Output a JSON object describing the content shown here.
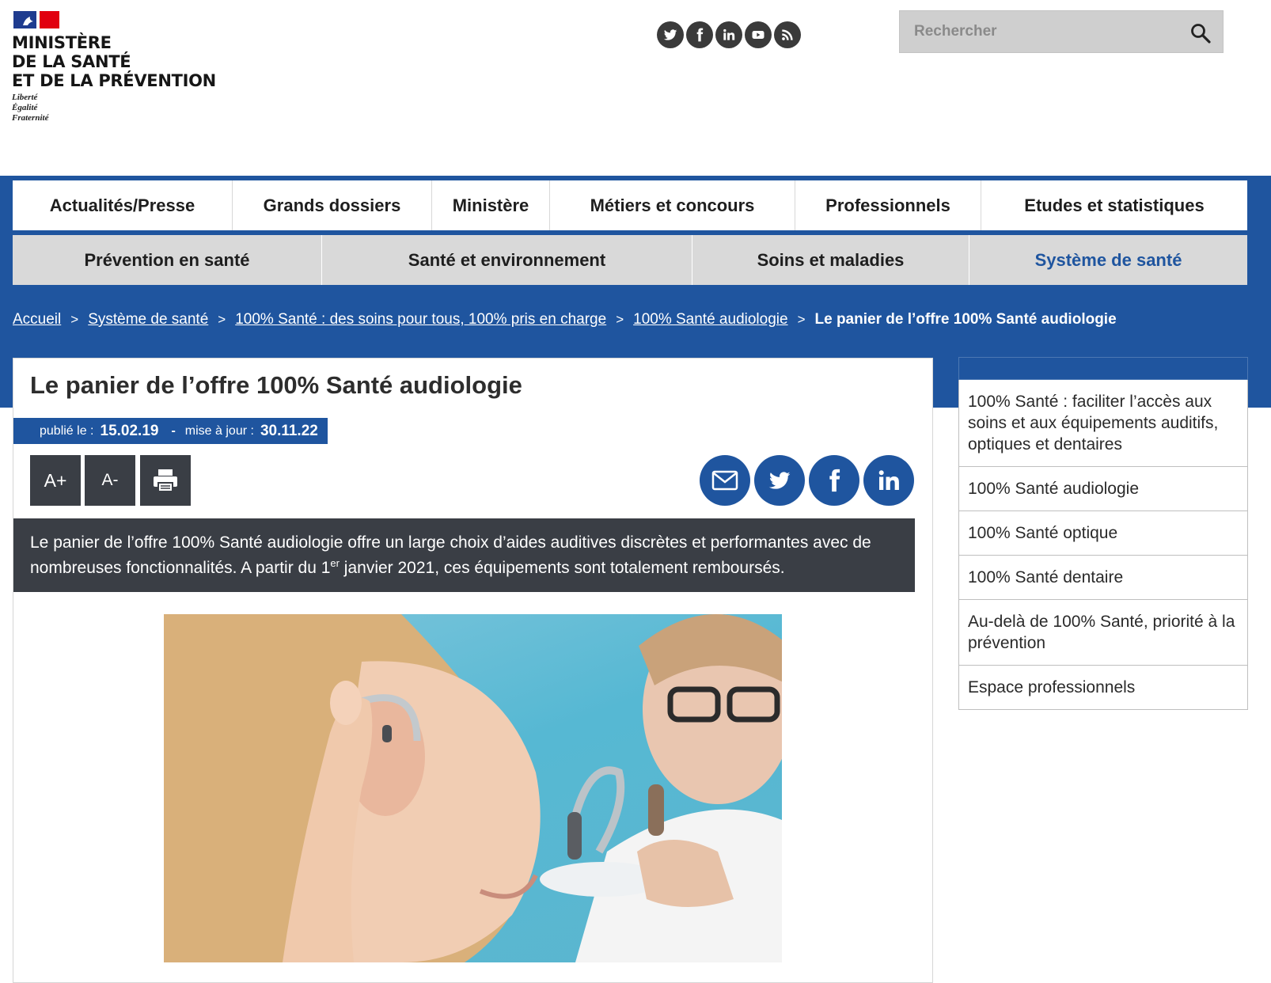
{
  "header": {
    "ministry_name": "MINISTÈRE\nDE LA SANTÉ\nET DE LA PRÉVENTION",
    "motto": "Liberté\nÉgalité\nFraternité",
    "social": [
      "twitter-icon",
      "facebook-icon",
      "linkedin-icon",
      "youtube-icon",
      "rss-icon"
    ],
    "search": {
      "placeholder": "Rechercher"
    }
  },
  "nav_primary": [
    "Actualités/Presse",
    "Grands dossiers",
    "Ministère",
    "Métiers et concours",
    "Professionnels",
    "Etudes et statistiques"
  ],
  "nav_secondary": [
    "Prévention en santé",
    "Santé et environnement",
    "Soins et maladies",
    "Système de santé"
  ],
  "breadcrumb": {
    "links": [
      "Accueil",
      "Système de santé",
      "100% Santé : des soins pour tous, 100% pris en charge",
      "100% Santé audiologie"
    ],
    "separator": ">",
    "current": "Le panier de l’offre 100% Santé audiologie"
  },
  "article": {
    "title": "Le panier de l’offre 100% Santé audiologie",
    "published_label": "publié le :",
    "published_date": "15.02.19",
    "updated_label": "mise à jour :",
    "updated_date": "30.11.22",
    "dash": "-",
    "tools": {
      "increase": "A+",
      "decrease": "A-"
    },
    "lead_part1": "Le panier de l’offre 100% Santé audiologie offre un large choix d’aides auditives discrètes et performantes avec de nombreuses fonctionnalités. A partir du 1",
    "lead_sup": "er",
    "lead_part2": " janvier 2021, ces équipements sont totalement remboursés."
  },
  "sidebar": {
    "links": [
      "100% Santé : faciliter l’accès aux soins et aux équipements auditifs, optiques et dentaires",
      "100% Santé audiologie",
      "100% Santé optique",
      "100% Santé dentaire",
      "Au-delà de 100% Santé, priorité à la prévention",
      "Espace professionnels"
    ]
  },
  "colors": {
    "brand_blue": "#1f559f",
    "dark_gray": "#3a3e45",
    "nav_gray": "#d9d9d9",
    "marianne_red": "#e1000f"
  }
}
